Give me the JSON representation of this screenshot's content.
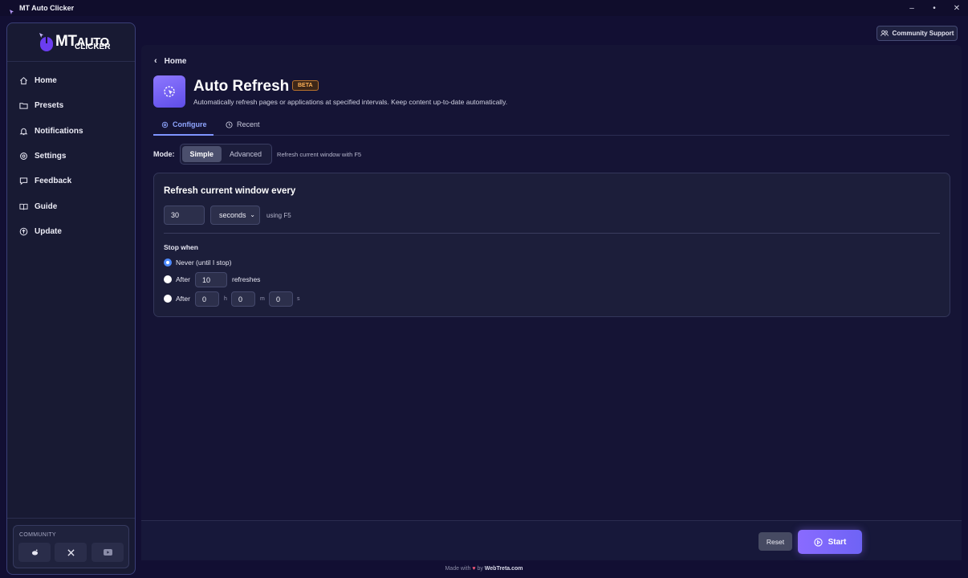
{
  "window": {
    "title": "MT Auto Clicker",
    "controls": [
      "–",
      "•",
      "✕"
    ]
  },
  "logo": {
    "line1": "MT",
    "line1b": "AUTO",
    "line2": "CLICKER"
  },
  "sidebar": {
    "items": [
      {
        "label": "Home",
        "icon": "home-icon"
      },
      {
        "label": "Presets",
        "icon": "folder-icon"
      },
      {
        "label": "Notifications",
        "icon": "bell-icon"
      },
      {
        "label": "Settings",
        "icon": "gear-icon"
      },
      {
        "label": "Feedback",
        "icon": "message-icon"
      },
      {
        "label": "Guide",
        "icon": "book-icon"
      },
      {
        "label": "Update",
        "icon": "upload-icon"
      }
    ],
    "community_label": "COMMUNITY",
    "community_links": [
      "reddit-icon",
      "x-icon",
      "youtube-icon"
    ]
  },
  "header": {
    "support_label": "Community Support"
  },
  "breadcrumb": {
    "back_label": "Home"
  },
  "feature": {
    "title": "Auto Refresh",
    "badge": "BETA",
    "description": "Automatically refresh pages or applications at specified intervals. Keep content up-to-date automatically."
  },
  "tabs": [
    {
      "label": "Configure",
      "active": true
    },
    {
      "label": "Recent",
      "active": false
    }
  ],
  "mode": {
    "label": "Mode:",
    "options": [
      "Simple",
      "Advanced"
    ],
    "selected": "Simple",
    "hint": "Refresh current window with F5"
  },
  "card": {
    "title": "Refresh current window every",
    "interval_value": "30",
    "interval_unit": "seconds",
    "using_text": "using F5",
    "stop_label": "Stop when",
    "options": {
      "never": "Never (until I stop)",
      "after_label": "After",
      "after_count": "10",
      "refreshes": "refreshes",
      "after_time_label": "After",
      "hours": "0",
      "minutes": "0",
      "seconds": "0",
      "h": "h",
      "m": "m",
      "s": "s"
    },
    "selected_option": "never"
  },
  "footer": {
    "reset_label": "Reset",
    "start_label": "Start",
    "made_with": "Made with",
    "by": "by",
    "site": "WebTreta.com"
  },
  "colors": {
    "accent": "#7f95ff",
    "start_gradient_a": "#8a6bff",
    "start_gradient_b": "#6e63f5",
    "beta": "#ffb257"
  }
}
